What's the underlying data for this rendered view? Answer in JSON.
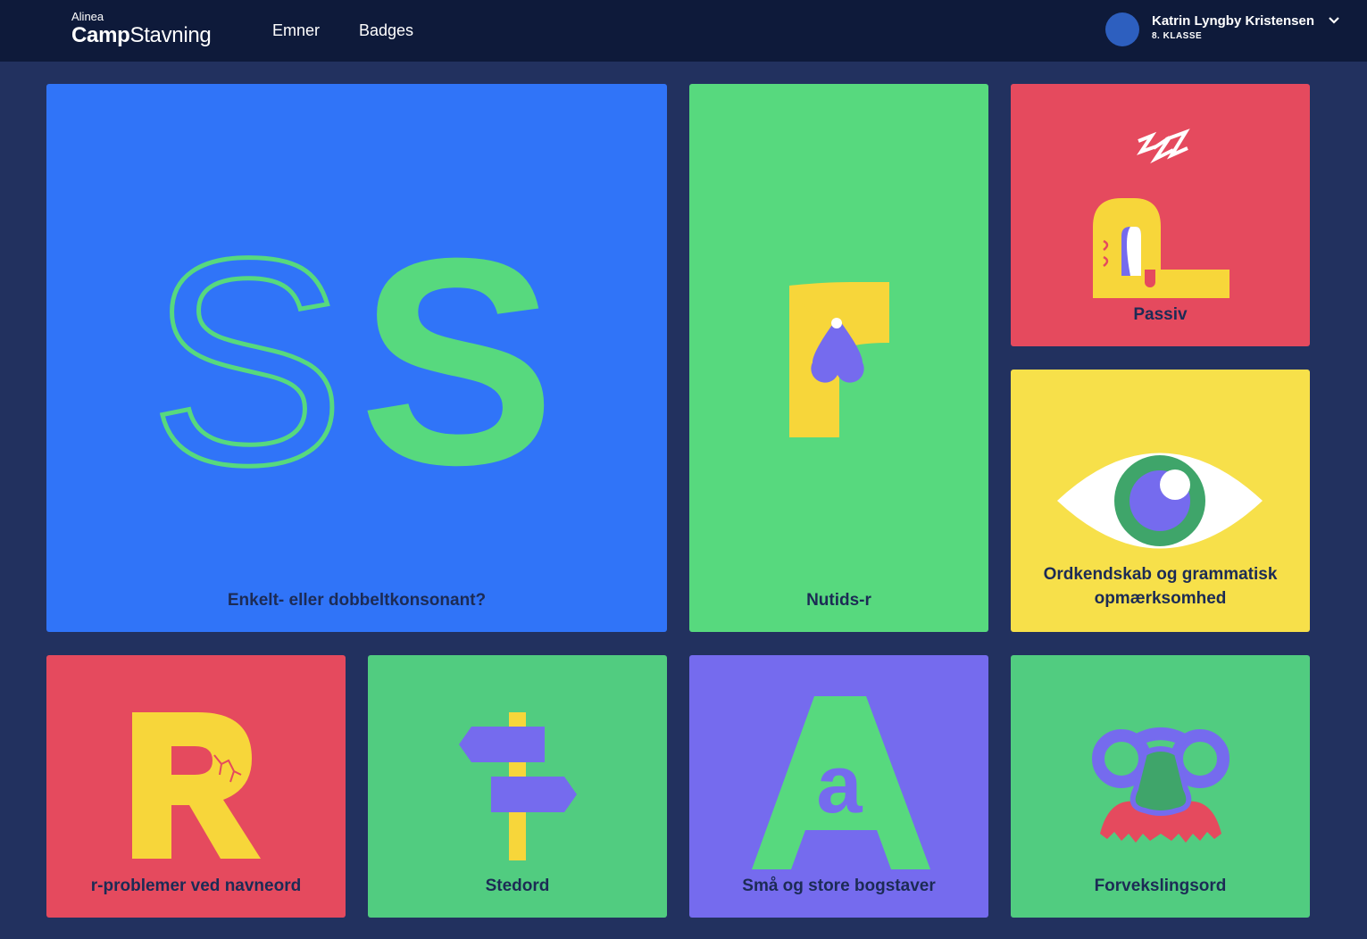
{
  "header": {
    "brand_small": "Alinea",
    "brand_bold": "Camp",
    "brand_rest": "Stavning",
    "nav": [
      "Emner",
      "Badges"
    ],
    "user_name": "Katrin Lyngby Kristensen",
    "user_class": "8. KLASSE"
  },
  "tiles": [
    {
      "label": "Enkelt- eller dobbeltkonsonant?",
      "color": "#3074f8",
      "icon": "ss-letters-icon"
    },
    {
      "label": "Nutids-r",
      "color": "#57d97e",
      "icon": "r-tear-icon"
    },
    {
      "label": "Passiv",
      "color": "#e54a5e",
      "icon": "sleeping-p-icon"
    },
    {
      "label": "Ordkendskab og grammatisk opmærksomhed",
      "color": "#f7e04a",
      "icon": "eye-icon"
    },
    {
      "label": "r-problemer ved navneord",
      "color": "#e54a5e",
      "icon": "cracked-r-icon"
    },
    {
      "label": "Stedord",
      "color": "#51cc80",
      "icon": "signpost-icon"
    },
    {
      "label": "Små og store bogstaver",
      "color": "#756bee",
      "icon": "a-letters-icon"
    },
    {
      "label": "Forvekslingsord",
      "color": "#51cc80",
      "icon": "disguise-glasses-icon"
    }
  ]
}
